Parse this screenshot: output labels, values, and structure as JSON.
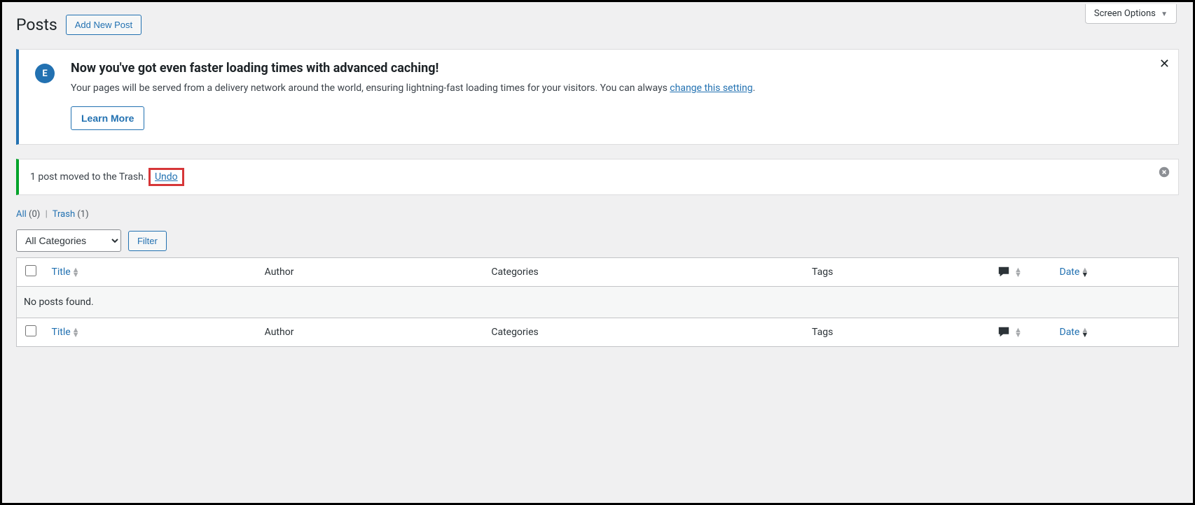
{
  "screen_options_label": "Screen Options",
  "page_title": "Posts",
  "add_new_label": "Add New Post",
  "banner": {
    "title": "Now you've got even faster loading times with advanced caching!",
    "text_before": "Your pages will be served from a delivery network around the world, ensuring lightning-fast loading times for your visitors. You can always ",
    "link_text": "change this setting",
    "text_after": ".",
    "learn_more": "Learn More"
  },
  "undo_notice": {
    "message": "1 post moved to the Trash.",
    "undo_label": "Undo"
  },
  "filters": {
    "all_label": "All",
    "all_count": "(0)",
    "trash_label": "Trash",
    "trash_count": "(1)"
  },
  "category_filter": {
    "selected": "All Categories",
    "filter_label": "Filter"
  },
  "table": {
    "columns": {
      "title": "Title",
      "author": "Author",
      "categories": "Categories",
      "tags": "Tags",
      "date": "Date"
    },
    "empty_message": "No posts found."
  }
}
